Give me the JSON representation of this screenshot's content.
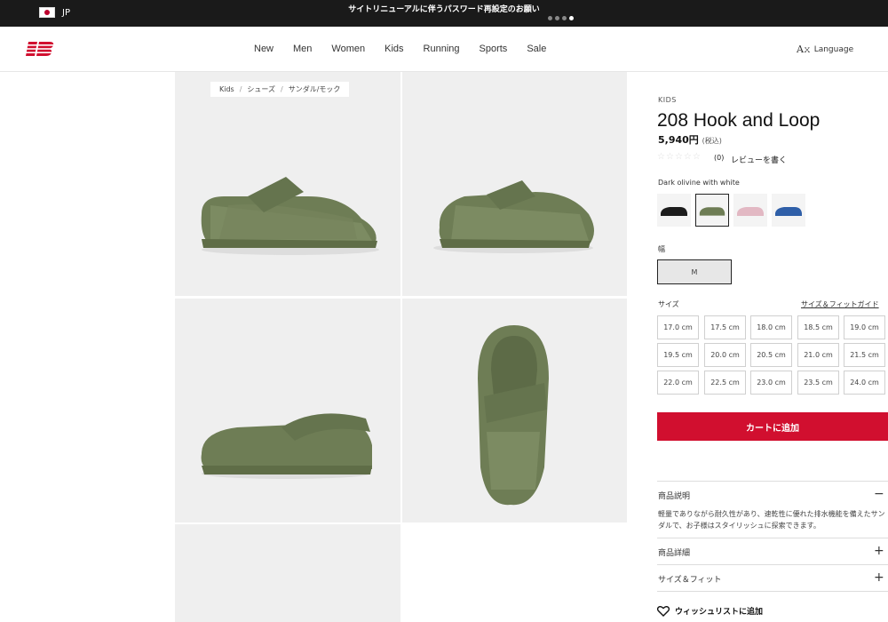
{
  "topbar": {
    "region": "JP",
    "announcement": "サイトリニューアルに伴うパスワード再設定のお願い",
    "dots": 4,
    "active_dot": 4
  },
  "header": {
    "logo": "new-balance-logo",
    "nav": [
      "New",
      "Men",
      "Women",
      "Kids",
      "Running",
      "Sports",
      "Sale"
    ],
    "language_label": "Language"
  },
  "breadcrumb": [
    "Kids",
    "シューズ",
    "サンダル/モック"
  ],
  "product": {
    "category": "KIDS",
    "title": "208 Hook and Loop",
    "price": "5,940円",
    "price_tax": "(税込)",
    "review_count": "(0)",
    "write_review": "レビューを書く",
    "rating": 0,
    "color_name": "Dark olivine with white",
    "swatches": [
      "black",
      "dark-olivine",
      "pink",
      "blue"
    ],
    "selected_swatch": 1,
    "width_label": "幅",
    "width_value": "M",
    "size_label": "サイズ",
    "size_guide": "サイズ＆フィットガイド",
    "sizes": [
      "17.0 cm",
      "17.5 cm",
      "18.0 cm",
      "18.5 cm",
      "19.0 cm",
      "19.5 cm",
      "20.0 cm",
      "20.5 cm",
      "21.0 cm",
      "21.5 cm",
      "22.0 cm",
      "22.5 cm",
      "23.0 cm",
      "23.5 cm",
      "24.0 cm"
    ],
    "add_to_cart": "カートに追加",
    "description_title": "商品説明",
    "description_text": "軽量でありながら耐久性があり、速乾性に優れた排水機能を備えたサンダルで、お子様はスタイリッシュに探索できます。",
    "details_title": "商品詳細",
    "fit_title": "サイズ＆フィット",
    "wishlist": "ウィッシュリストに追加"
  },
  "colors": {
    "brand_red": "#d10f2f",
    "shoe_olive": "#6e7d55",
    "topbar": "#1a1a1a"
  }
}
